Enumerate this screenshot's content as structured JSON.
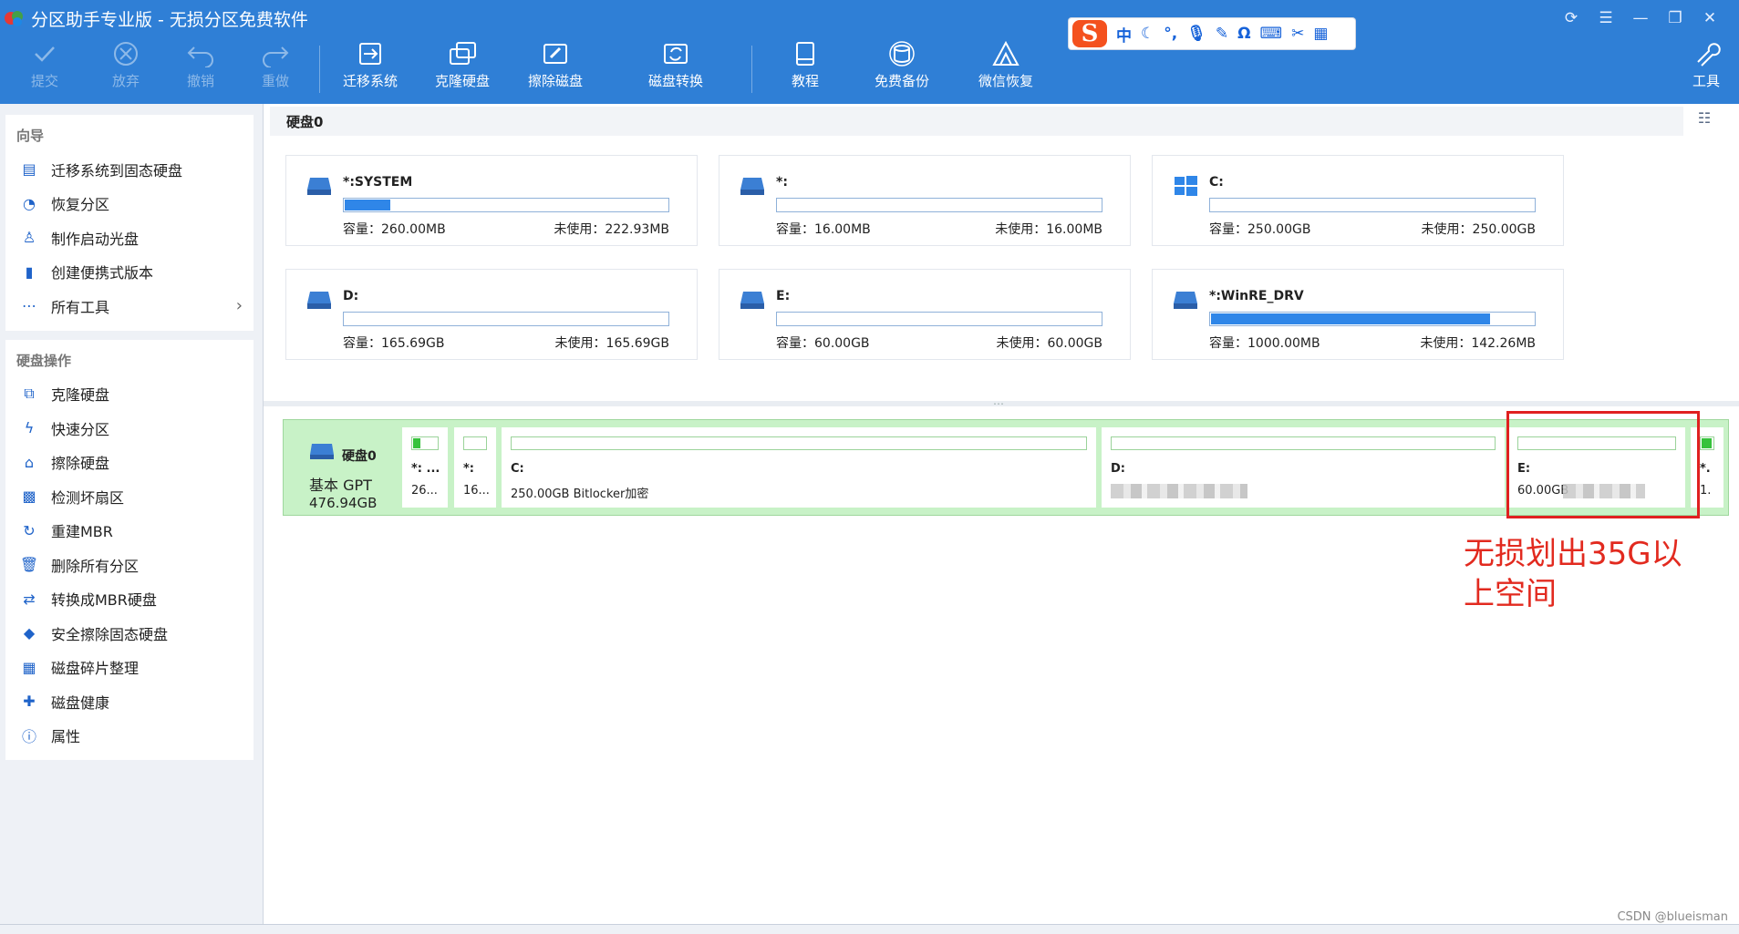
{
  "app": {
    "title": "分区助手专业版 - 无损分区免费软件"
  },
  "toolbar": {
    "items": [
      {
        "label": "提交",
        "icon": "check-icon",
        "enabled": false
      },
      {
        "label": "放弃",
        "icon": "discard-icon",
        "enabled": false
      },
      {
        "label": "撤销",
        "icon": "undo-icon",
        "enabled": false
      },
      {
        "label": "重做",
        "icon": "redo-icon",
        "enabled": false
      },
      {
        "label": "迁移系统",
        "icon": "migrate-os-icon",
        "enabled": true
      },
      {
        "label": "克隆硬盘",
        "icon": "clone-disk-icon",
        "enabled": true
      },
      {
        "label": "擦除磁盘",
        "icon": "wipe-disk-icon",
        "enabled": true
      },
      {
        "label": "磁盘转换",
        "icon": "disk-convert-icon",
        "enabled": true
      },
      {
        "label": "教程",
        "icon": "tutorial-icon",
        "enabled": true
      },
      {
        "label": "免费备份",
        "icon": "backup-icon",
        "enabled": true
      },
      {
        "label": "微信恢复",
        "icon": "wechat-recovery-icon",
        "enabled": true
      }
    ],
    "tools_label": "工具"
  },
  "ime": {
    "logo": "S",
    "lang": "中"
  },
  "sidebar": {
    "wizard_title": "向导",
    "wizard_items": [
      {
        "label": "迁移系统到固态硬盘",
        "icon": "migrate-ssd-icon"
      },
      {
        "label": "恢复分区",
        "icon": "restore-partition-icon"
      },
      {
        "label": "制作启动光盘",
        "icon": "boot-disc-icon"
      },
      {
        "label": "创建便携式版本",
        "icon": "portable-icon"
      },
      {
        "label": "所有工具",
        "icon": "all-tools-icon"
      }
    ],
    "disk_ops_title": "硬盘操作",
    "disk_ops_items": [
      {
        "label": "克隆硬盘",
        "icon": "clone-disk-icon"
      },
      {
        "label": "快速分区",
        "icon": "quick-partition-icon"
      },
      {
        "label": "擦除硬盘",
        "icon": "wipe-disk-icon"
      },
      {
        "label": "检测坏扇区",
        "icon": "bad-sector-icon"
      },
      {
        "label": "重建MBR",
        "icon": "rebuild-mbr-icon"
      },
      {
        "label": "删除所有分区",
        "icon": "delete-partitions-icon"
      },
      {
        "label": "转换成MBR硬盘",
        "icon": "convert-mbr-icon"
      },
      {
        "label": "安全擦除固态硬盘",
        "icon": "secure-erase-icon"
      },
      {
        "label": "磁盘碎片整理",
        "icon": "defrag-icon"
      },
      {
        "label": "磁盘健康",
        "icon": "disk-health-icon"
      },
      {
        "label": "属性",
        "icon": "info-icon"
      }
    ]
  },
  "disk_panel": {
    "title": "硬盘0",
    "partitions": [
      {
        "name": "*:SYSTEM",
        "capacity": "容量：260.00MB",
        "unused": "未使用：222.93MB",
        "used_fraction": 0.14,
        "icon": "drive-icon"
      },
      {
        "name": "*:",
        "capacity": "容量：16.00MB",
        "unused": "未使用：16.00MB",
        "used_fraction": 0.0,
        "icon": "drive-icon"
      },
      {
        "name": "C:",
        "capacity": "容量：250.00GB",
        "unused": "未使用：250.00GB",
        "used_fraction": 0.0,
        "icon": "windows-icon"
      },
      {
        "name": "D:",
        "capacity": "容量：165.69GB",
        "unused": "未使用：165.69GB",
        "used_fraction": 0.0,
        "icon": "drive-icon"
      },
      {
        "name": "E:",
        "capacity": "容量：60.00GB",
        "unused": "未使用：60.00GB",
        "used_fraction": 0.0,
        "icon": "drive-icon"
      },
      {
        "name": "*:WinRE_DRV",
        "capacity": "容量：1000.00MB",
        "unused": "未使用：142.26MB",
        "used_fraction": 0.86,
        "icon": "drive-icon"
      }
    ]
  },
  "disk_map": {
    "name": "硬盘0",
    "type": "基本 GPT",
    "size": "476.94GB",
    "segments": [
      {
        "label": "*: ...",
        "info": "26...",
        "used_fraction": 0.3
      },
      {
        "label": "*:",
        "info": "16...",
        "used_fraction": 0.0
      },
      {
        "label": "C:",
        "info": "250.00GB Bitlocker加密",
        "used_fraction": 0.0
      },
      {
        "label": "D:",
        "info": "",
        "used_fraction": 0.0
      },
      {
        "label": "E:",
        "info": "60.00GB",
        "used_fraction": 0.0
      },
      {
        "label": "*.",
        "info": "1.",
        "used_fraction": 0.8
      }
    ]
  },
  "annotation": {
    "line1": "无损划出35G以",
    "line2": "上空间",
    "color": "#e22a1f"
  },
  "watermark": "CSDN @blueisman",
  "colors": {
    "titlebar": "#2f7fd6",
    "accent": "#2f86e8",
    "disk_map_bg": "#c8f2c7"
  }
}
